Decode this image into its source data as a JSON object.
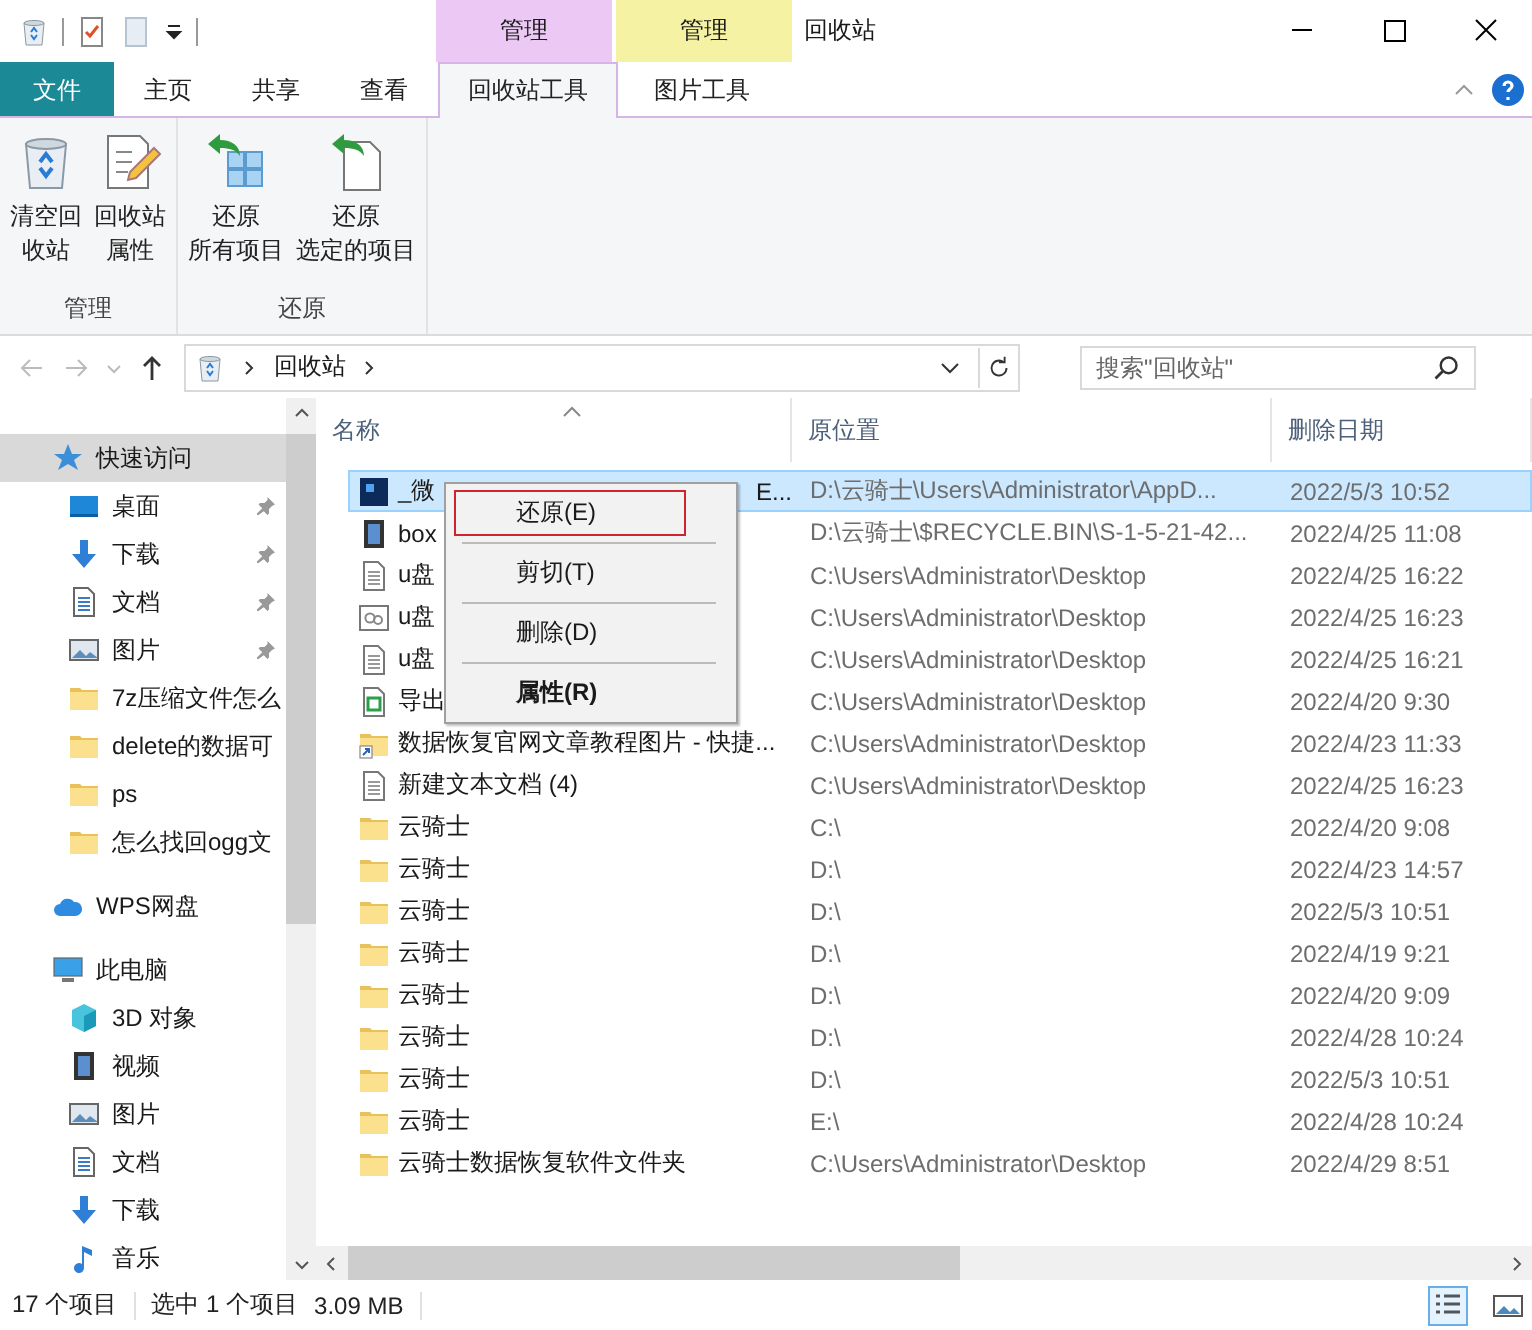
{
  "window": {
    "title": "回收站",
    "context_tabs": [
      {
        "label": "管理",
        "color": "#ecc9f5"
      },
      {
        "label": "管理",
        "color": "#f5f3a3"
      }
    ]
  },
  "tabs": [
    {
      "label": "文件",
      "kind": "file",
      "selected": false
    },
    {
      "label": "主页",
      "kind": "tab",
      "selected": false
    },
    {
      "label": "共享",
      "kind": "tab",
      "selected": false
    },
    {
      "label": "查看",
      "kind": "tab",
      "selected": false
    },
    {
      "label": "回收站工具",
      "kind": "tab",
      "selected": true
    },
    {
      "label": "图片工具",
      "kind": "tab",
      "selected": false
    }
  ],
  "ribbon": {
    "groups": [
      {
        "label": "管理",
        "buttons": [
          {
            "kind": "bin",
            "lines": [
              "清空回",
              "收站"
            ]
          },
          {
            "kind": "props",
            "lines": [
              "回收站",
              "属性"
            ]
          }
        ]
      },
      {
        "label": "还原",
        "buttons": [
          {
            "kind": "restoreall",
            "lines": [
              "还原",
              "所有项目"
            ]
          },
          {
            "kind": "restore",
            "lines": [
              "还原",
              "选定的项目"
            ]
          }
        ]
      }
    ]
  },
  "address": {
    "path": "回收站",
    "search": {
      "placeholder": "搜索\"回收站\""
    }
  },
  "sidebar": {
    "items": [
      {
        "label": "快速访问",
        "kind": "star",
        "selected": true,
        "children": [
          {
            "label": "桌面",
            "kind": "desktop",
            "pinned": true
          },
          {
            "label": "下载",
            "kind": "download",
            "pinned": true
          },
          {
            "label": "文档",
            "kind": "doc",
            "pinned": true
          },
          {
            "label": "图片",
            "kind": "picture",
            "pinned": true
          },
          {
            "label": "7z压缩文件怎么",
            "kind": "folder",
            "pinned": false
          },
          {
            "label": "delete的数据可",
            "kind": "folder",
            "pinned": false
          },
          {
            "label": "ps",
            "kind": "folder",
            "pinned": false
          },
          {
            "label": "怎么找回ogg文",
            "kind": "folder",
            "pinned": false
          }
        ]
      },
      {
        "label": "WPS网盘",
        "kind": "cloud",
        "selected": false
      },
      {
        "label": "此电脑",
        "kind": "pc",
        "selected": false,
        "children": [
          {
            "label": "3D 对象",
            "kind": "cube",
            "pinned": false
          },
          {
            "label": "视频",
            "kind": "video",
            "pinned": false
          },
          {
            "label": "图片",
            "kind": "picture",
            "pinned": false
          },
          {
            "label": "文档",
            "kind": "doc",
            "pinned": false
          },
          {
            "label": "下载",
            "kind": "download",
            "pinned": false
          },
          {
            "label": "音乐",
            "kind": "music",
            "pinned": false
          }
        ]
      }
    ]
  },
  "table": {
    "columns": [
      "名称",
      "原位置",
      "删除日期"
    ],
    "rows": [
      {
        "kind": "ps",
        "name": "_微",
        "name_end": "E...",
        "location": "D:\\云骑士\\Users\\Administrator\\AppD...",
        "date": "2022/5/3 10:52",
        "selected": true
      },
      {
        "kind": "video",
        "name": "box",
        "location": "D:\\云骑士\\$RECYCLE.BIN\\S-1-5-21-42...",
        "date": "2022/4/25 11:08",
        "selected": false
      },
      {
        "kind": "text",
        "name": "u盘",
        "location": "C:\\Users\\Administrator\\Desktop",
        "date": "2022/4/25 16:22",
        "selected": false
      },
      {
        "kind": "settings",
        "name": "u盘",
        "location": "C:\\Users\\Administrator\\Desktop",
        "date": "2022/4/25 16:23",
        "selected": false
      },
      {
        "kind": "text",
        "name": "u盘",
        "location": "C:\\Users\\Administrator\\Desktop",
        "date": "2022/4/25 16:21",
        "selected": false
      },
      {
        "kind": "sheet",
        "name": "导出",
        "location": "C:\\Users\\Administrator\\Desktop",
        "date": "2022/4/20 9:30",
        "selected": false
      },
      {
        "kind": "shortcut",
        "name": "数据恢复官网文章教程图片 - 快捷...",
        "location": "C:\\Users\\Administrator\\Desktop",
        "date": "2022/4/23 11:33",
        "selected": false
      },
      {
        "kind": "text",
        "name": "新建文本文档 (4)",
        "location": "C:\\Users\\Administrator\\Desktop",
        "date": "2022/4/25 16:23",
        "selected": false
      },
      {
        "kind": "folder",
        "name": "云骑士",
        "location": "C:\\",
        "date": "2022/4/20 9:08",
        "selected": false
      },
      {
        "kind": "folder",
        "name": "云骑士",
        "location": "D:\\",
        "date": "2022/4/23 14:57",
        "selected": false
      },
      {
        "kind": "folder",
        "name": "云骑士",
        "location": "D:\\",
        "date": "2022/5/3 10:51",
        "selected": false
      },
      {
        "kind": "folder",
        "name": "云骑士",
        "location": "D:\\",
        "date": "2022/4/19 9:21",
        "selected": false
      },
      {
        "kind": "folder",
        "name": "云骑士",
        "location": "D:\\",
        "date": "2022/4/20 9:09",
        "selected": false
      },
      {
        "kind": "folder",
        "name": "云骑士",
        "location": "D:\\",
        "date": "2022/4/28 10:24",
        "selected": false
      },
      {
        "kind": "folder",
        "name": "云骑士",
        "location": "D:\\",
        "date": "2022/5/3 10:51",
        "selected": false
      },
      {
        "kind": "folder",
        "name": "云骑士",
        "location": "E:\\",
        "date": "2022/4/28 10:24",
        "selected": false
      },
      {
        "kind": "folder",
        "name": "云骑士数据恢复软件文件夹",
        "location": "C:\\Users\\Administrator\\Desktop",
        "date": "2022/4/29 8:51",
        "selected": false
      }
    ]
  },
  "context_menu": {
    "items": [
      {
        "label": "还原(E)",
        "selected": true,
        "default": false
      },
      {
        "label": "剪切(T)",
        "selected": false,
        "default": false
      },
      {
        "label": "删除(D)",
        "selected": false,
        "default": false
      },
      {
        "label": "属性(R)",
        "selected": false,
        "default": true
      }
    ]
  },
  "status_bar": {
    "count": "17 个项目",
    "selection": "选中 1 个项目",
    "size": "3.09 MB",
    "views": [
      {
        "kind": "details",
        "selected": true
      },
      {
        "kind": "thumbs",
        "selected": false
      }
    ]
  }
}
